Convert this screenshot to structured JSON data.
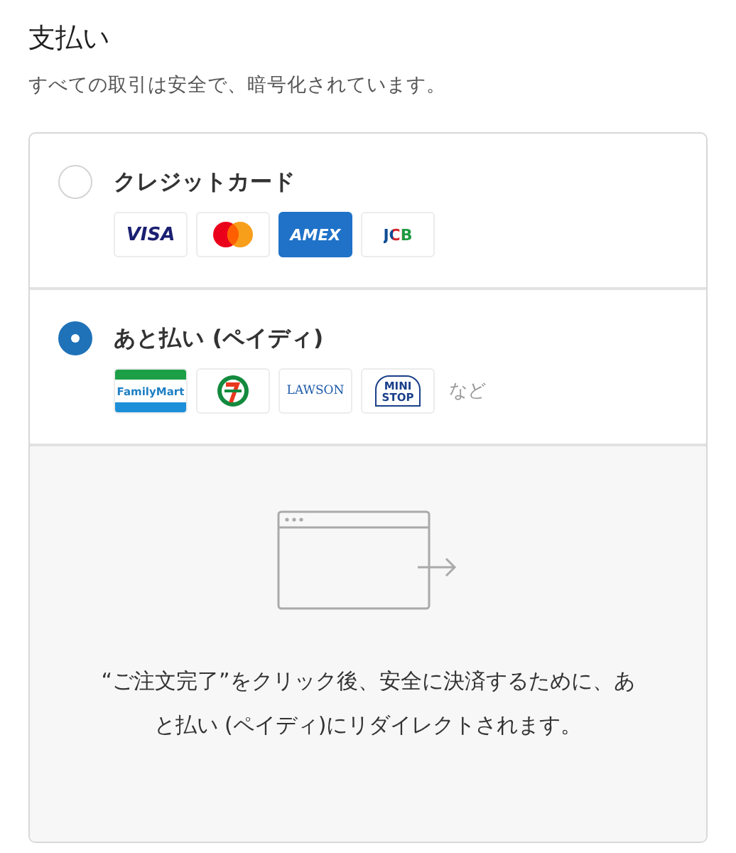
{
  "heading": "支払い",
  "subheading": "すべての取引は安全で、暗号化されています。",
  "options": [
    {
      "label": "クレジットカード",
      "selected": false,
      "logos": [
        {
          "kind": "visa",
          "label": "VISA"
        },
        {
          "kind": "mastercard"
        },
        {
          "kind": "amex",
          "label": "AMEX"
        },
        {
          "kind": "jcb",
          "label": "JCB"
        }
      ]
    },
    {
      "label": "あと払い (ペイディ)",
      "selected": true,
      "logos": [
        {
          "kind": "familymart",
          "label": "FamilyMart"
        },
        {
          "kind": "seven"
        },
        {
          "kind": "lawson",
          "label": "LAWSON"
        },
        {
          "kind": "ministop",
          "label": "MINI STOP"
        }
      ],
      "note": "など"
    }
  ],
  "redirect_message": "“ご注文完了”をクリック後、安全に決済するために、あと払い (ペイディ)にリダイレクトされます。"
}
